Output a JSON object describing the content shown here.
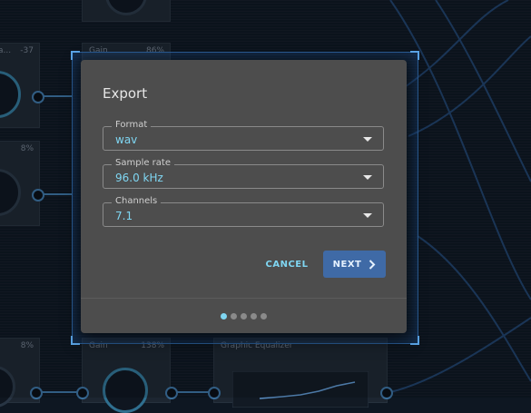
{
  "background_nodes": {
    "top_left": {
      "title": "a...",
      "value": "-37"
    },
    "mid_left": {
      "value": "8%"
    },
    "bottom_left": {
      "value": "8%"
    },
    "gain_top": {
      "title": "Gain",
      "value": "86%"
    },
    "gain_bottom": {
      "title": "Gain",
      "value": "138%"
    },
    "equalizer": {
      "title": "Graphic Equalizer"
    }
  },
  "dialog": {
    "title": "Export",
    "fields": [
      {
        "label": "Format",
        "value": "wav"
      },
      {
        "label": "Sample rate",
        "value": "96.0 kHz"
      },
      {
        "label": "Channels",
        "value": "7.1"
      }
    ],
    "cancel_label": "CANCEL",
    "next_label": "NEXT",
    "steps_total": 5,
    "current_step": 1
  },
  "colors": {
    "accent": "#7fd6f2",
    "primary_button": "#3f6aa6",
    "dialog_bg": "#4d4d4d",
    "canvas_bg": "#0e1722"
  }
}
